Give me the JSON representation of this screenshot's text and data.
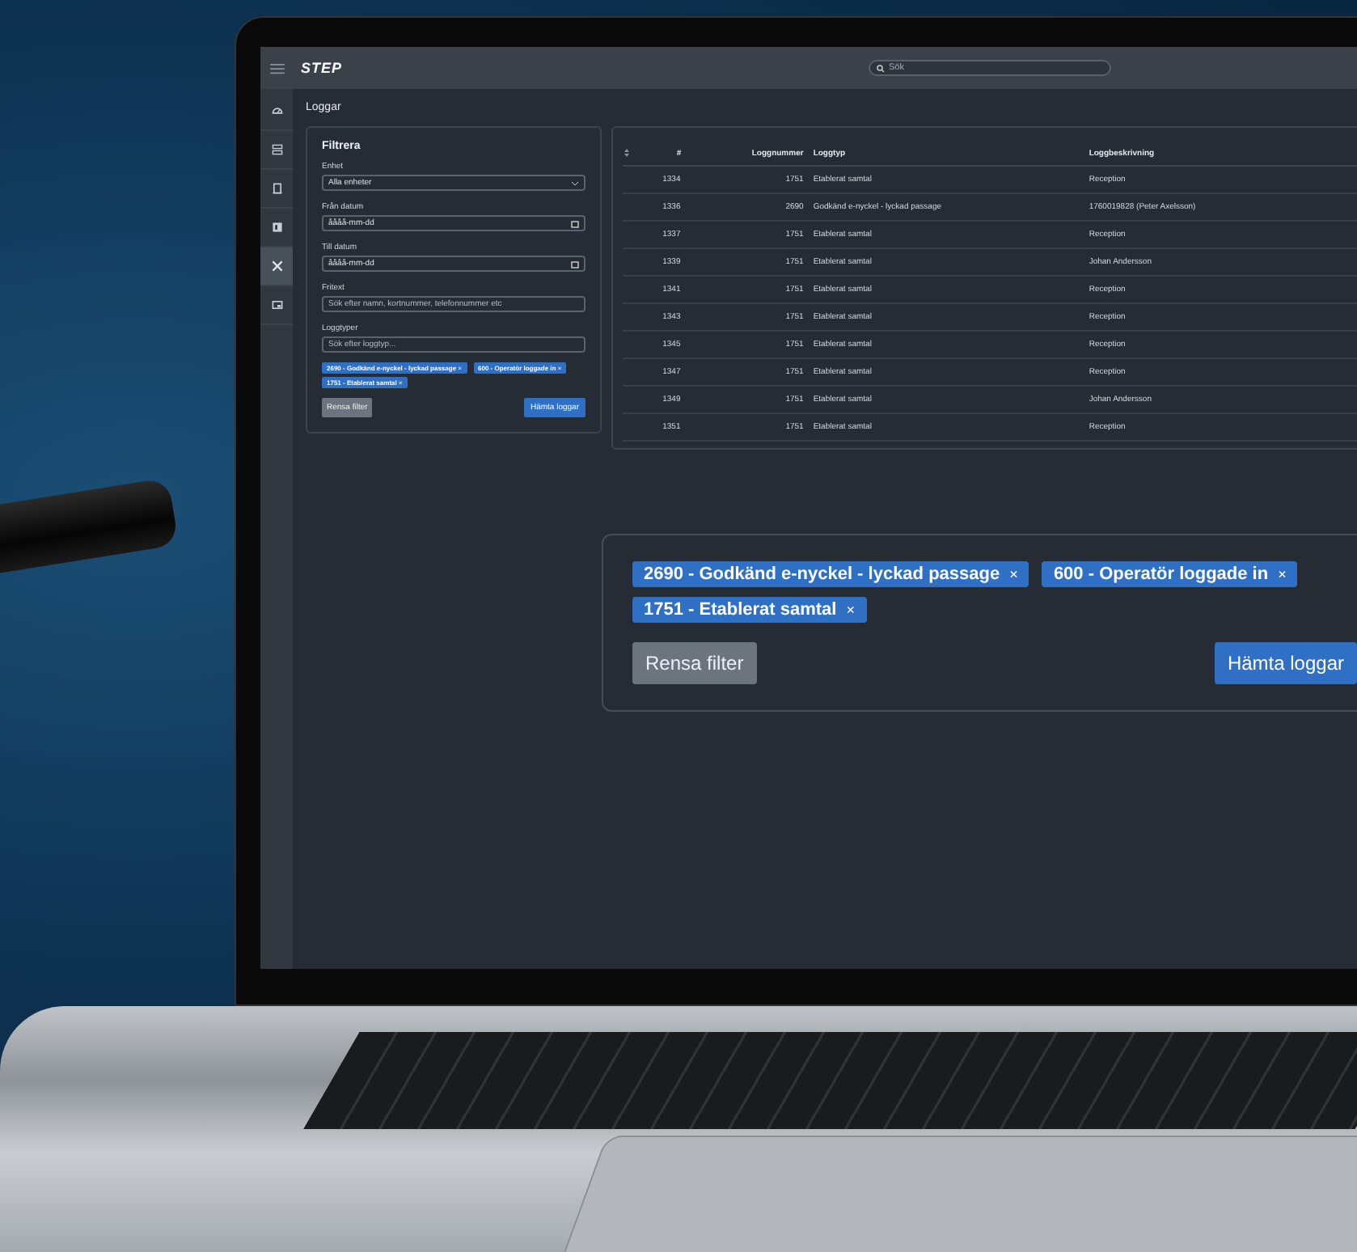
{
  "topbar": {
    "logo": "STEP",
    "search_placeholder": "Sök"
  },
  "sidebar": {
    "items": [
      {
        "kind": "gauge",
        "selected": false
      },
      {
        "kind": "server",
        "selected": false
      },
      {
        "kind": "door",
        "selected": false
      },
      {
        "kind": "panel",
        "selected": false
      },
      {
        "kind": "tools",
        "selected": true
      },
      {
        "kind": "screen",
        "selected": false
      }
    ]
  },
  "page_title": "Loggar",
  "filter": {
    "title": "Filtrera",
    "fields": [
      {
        "kind": "select",
        "label": "Enhet",
        "value": "Alla enheter"
      },
      {
        "kind": "date",
        "label": "Från datum",
        "value": "åååå-mm-dd"
      },
      {
        "kind": "date",
        "label": "Till datum",
        "value": "åååå-mm-dd"
      },
      {
        "kind": "text",
        "label": "Fritext",
        "placeholder": "Sök efter namn, kortnummer, telefonnummer etc"
      },
      {
        "kind": "text",
        "label": "Loggtyper",
        "placeholder": "Sök efter loggtyp..."
      }
    ],
    "chips": [
      {
        "label": "2690 - Godkänd e-nyckel - lyckad passage",
        "remove": "×"
      },
      {
        "label": "600 - Operatör loggade in",
        "remove": "×"
      },
      {
        "label": "1751 - Etablerat samtal",
        "remove": "×"
      }
    ],
    "clear_button": "Rensa filter",
    "fetch_button": "Hämta loggar"
  },
  "table": {
    "columns": [
      "#",
      "Loggnummer",
      "Loggtyp",
      "Loggbeskrivning"
    ],
    "rows": [
      [
        "1334",
        "1751",
        "Etablerat samtal",
        "Reception"
      ],
      [
        "1336",
        "2690",
        "Godkänd e-nyckel - lyckad passage",
        "1760019828 (Peter Axelsson)"
      ],
      [
        "1337",
        "1751",
        "Etablerat samtal",
        "Reception"
      ],
      [
        "1339",
        "1751",
        "Etablerat samtal",
        "Johan Andersson"
      ],
      [
        "1341",
        "1751",
        "Etablerat samtal",
        "Reception"
      ],
      [
        "1343",
        "1751",
        "Etablerat samtal",
        "Reception"
      ],
      [
        "1345",
        "1751",
        "Etablerat samtal",
        "Reception"
      ],
      [
        "1347",
        "1751",
        "Etablerat samtal",
        "Reception"
      ],
      [
        "1349",
        "1751",
        "Etablerat samtal",
        "Johan Andersson"
      ],
      [
        "1351",
        "1751",
        "Etablerat samtal",
        "Reception"
      ]
    ]
  },
  "callout": {
    "chips": [
      {
        "label": "2690 - Godkänd e-nyckel - lyckad passage",
        "remove": "×"
      },
      {
        "label": "600 - Operatör loggade in",
        "remove": "×"
      },
      {
        "label": "1751 - Etablerat samtal",
        "remove": "×"
      }
    ],
    "clear_button": "Rensa filter",
    "fetch_button": "Hämta loggar"
  }
}
